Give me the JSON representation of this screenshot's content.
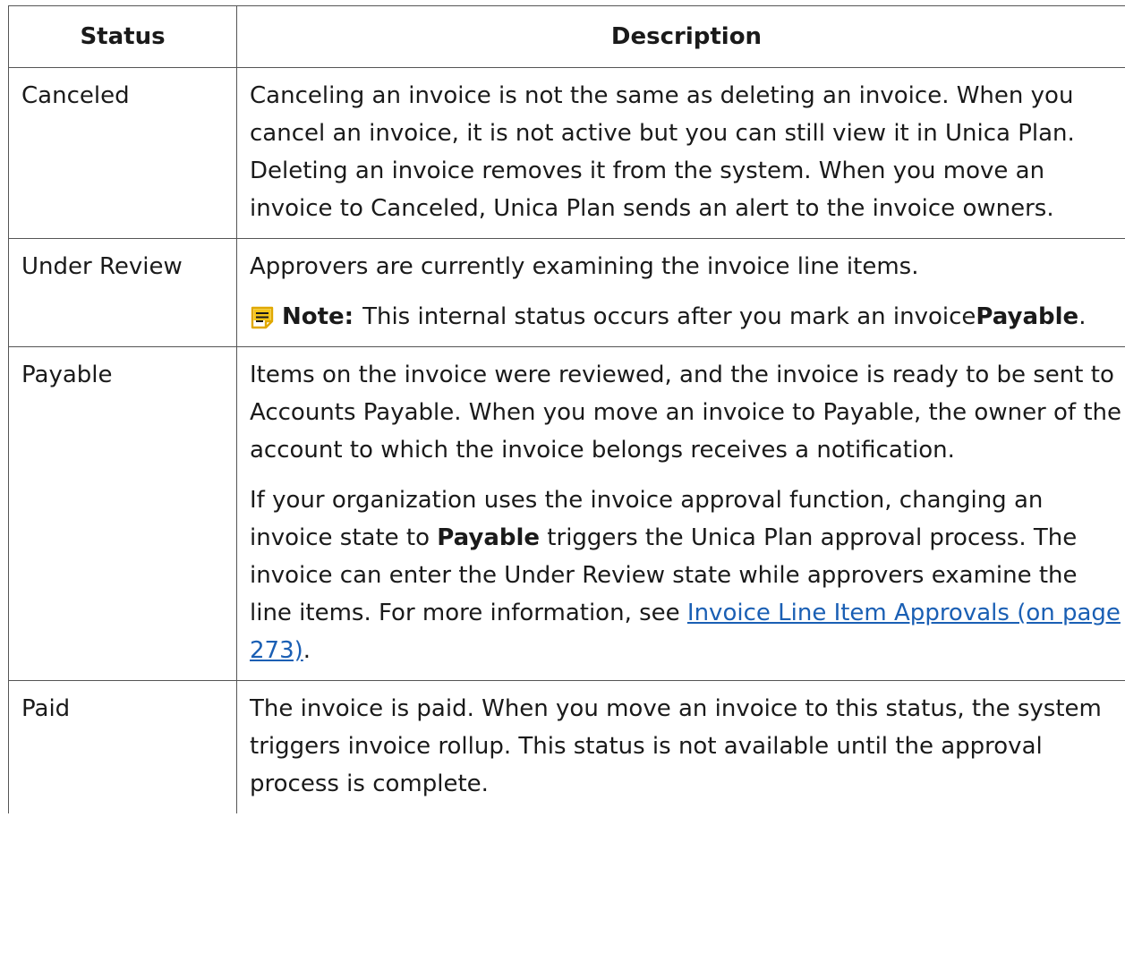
{
  "table": {
    "headers": {
      "status": "Status",
      "description": "Description"
    },
    "rows": {
      "canceled": {
        "status": "Canceled",
        "text": "Canceling an invoice is not the same as deleting an invoice. When you cancel an invoice, it is not active but you can still view it in Unica Plan. Deleting an invoice removes it from the system. When you move an invoice to Canceled, Unica Plan sends an alert to the invoice owners."
      },
      "under_review": {
        "status": "Under Review",
        "text": "Approvers are currently examining the invoice line items.",
        "note_label": "Note:",
        "note_text": "This internal status occurs after you mark an invoice ",
        "note_bold": "Payable",
        "note_end": ".",
        "note_icon": "note-icon"
      },
      "payable": {
        "status": "Payable",
        "text1": "Items on the invoice were reviewed, and the invoice is ready to be sent to Accounts Payable. When you move an invoice to Payable, the owner of the account to which the invoice belongs receives a notification.",
        "text2_a": "If your organization uses the invoice approval function, changing an invoice state to ",
        "text2_bold": "Payable",
        "text2_b": " triggers the Unica Plan approval process. The invoice can enter the Under Review state while approvers examine the line items. For more information, see ",
        "link": "Invoice Line Item Approvals (on page 273)",
        "text2_end": "."
      },
      "paid": {
        "status": "Paid",
        "text": "The invoice is paid. When you move an invoice to this status, the system triggers invoice rollup. This status is not available until the approval process is complete."
      }
    }
  },
  "colors": {
    "link": "#1a5fb4",
    "note_icon": "#f5c518",
    "border": "#555555"
  }
}
